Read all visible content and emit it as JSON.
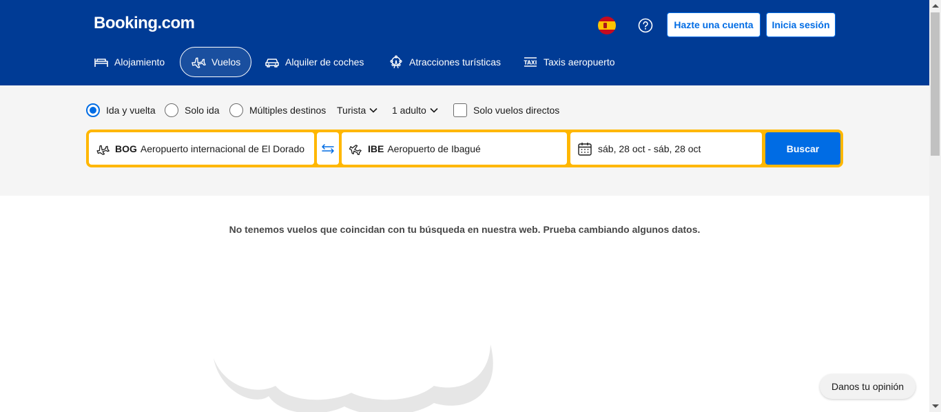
{
  "header": {
    "logo": "Booking.com",
    "register_label": "Hazte una cuenta",
    "login_label": "Inicia sesión"
  },
  "nav": {
    "items": [
      {
        "label": "Alojamiento",
        "icon": "bed-icon"
      },
      {
        "label": "Vuelos",
        "icon": "plane-icon",
        "active": true
      },
      {
        "label": "Alquiler de coches",
        "icon": "car-icon"
      },
      {
        "label": "Atracciones turísticas",
        "icon": "ferris-wheel-icon"
      },
      {
        "label": "Taxis aeropuerto",
        "icon": "taxi-icon"
      }
    ]
  },
  "search": {
    "trip_types": [
      "Ida y vuelta",
      "Solo ida",
      "Múltiples destinos"
    ],
    "selected_trip_type": "Ida y vuelta",
    "cabin_class": "Turista",
    "passengers": "1 adulto",
    "direct_only_label": "Solo vuelos directos",
    "direct_only": false,
    "from_code": "BOG",
    "from_name": "Aeropuerto internacional de El Dorado",
    "to_code": "IBE",
    "to_name": "Aeropuerto de Ibagué",
    "dates": "sáb, 28 oct - sáb, 28 oct",
    "search_label": "Buscar"
  },
  "results": {
    "empty_message": "No tenemos vuelos que coincidan con tu búsqueda en nuestra web. Prueba cambiando algunos datos."
  },
  "feedback_label": "Danos tu opinión",
  "colors": {
    "brand_blue": "#003b95",
    "accent_blue": "#006ce4",
    "search_border": "#ffb700"
  }
}
